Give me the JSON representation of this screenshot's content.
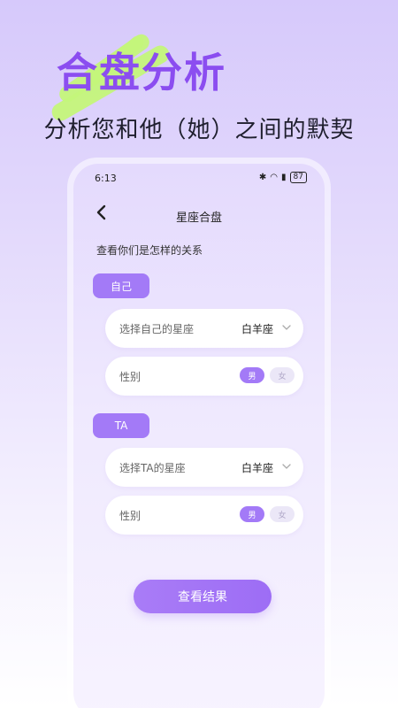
{
  "promo": {
    "title": "合盘分析",
    "subtitle": "分析您和他（她）之间的默契"
  },
  "status_bar": {
    "time": "6:13",
    "battery": "87"
  },
  "nav": {
    "title": "星座合盘"
  },
  "intro": "查看你们是怎样的关系",
  "self": {
    "tag": "自己",
    "zodiac_label": "选择自己的星座",
    "zodiac_value": "白羊座",
    "gender_label": "性别",
    "male": "男",
    "female": "女"
  },
  "partner": {
    "tag": "TA",
    "zodiac_label": "选择TA的星座",
    "zodiac_value": "白羊座",
    "gender_label": "性别",
    "male": "男",
    "female": "女"
  },
  "result_button": "查看结果",
  "colors": {
    "accent": "#a37af7",
    "title": "#8b4df0",
    "highlight": "#c4f57a"
  }
}
